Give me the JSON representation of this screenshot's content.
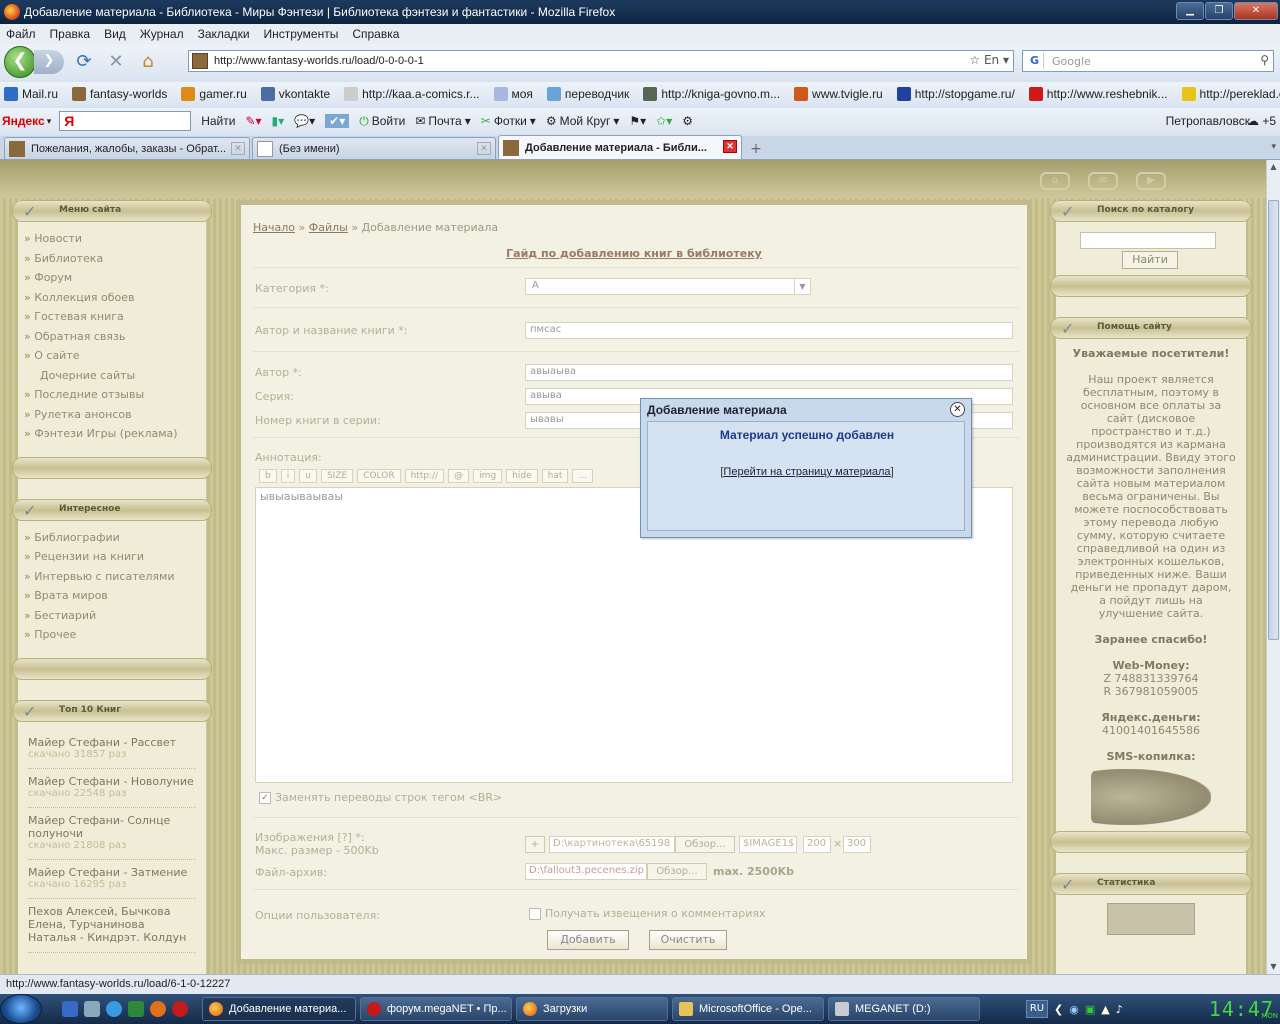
{
  "window": {
    "title": "Добавление материала - Библиотека - Миры Фэнтези | Библиотека фэнтези и фантастики - Mozilla Firefox"
  },
  "menu": [
    "Файл",
    "Правка",
    "Вид",
    "Журнал",
    "Закладки",
    "Инструменты",
    "Справка"
  ],
  "nav": {
    "url": "http://www.fantasy-worlds.ru/load/0-0-0-0-1",
    "search_placeholder": "Google",
    "lang": "En"
  },
  "bookmarks": [
    {
      "label": "Mail.ru",
      "icon": "at-icon",
      "color": "#2d6ec7"
    },
    {
      "label": "fantasy-worlds",
      "icon": "book-icon",
      "color": "#8a6a3c"
    },
    {
      "label": "gamer.ru",
      "icon": "gamer-icon",
      "color": "#e08a1a"
    },
    {
      "label": "vkontakte",
      "icon": "vk-icon",
      "color": "#4a6ea0"
    },
    {
      "label": "http://kaa.a-comics.r...",
      "icon": "page-icon",
      "color": "#cccccc"
    },
    {
      "label": "моя",
      "icon": "crystal-icon",
      "color": "#a8b8e0"
    },
    {
      "label": "переводчик",
      "icon": "translate-icon",
      "color": "#6aa3d8"
    },
    {
      "label": "http://kniga-govno.m...",
      "icon": "skull-icon",
      "color": "#556655"
    },
    {
      "label": "www.tvigle.ru",
      "icon": "tvigle-icon",
      "color": "#d05a1a"
    },
    {
      "label": "http://stopgame.ru/",
      "icon": "stopgame-icon",
      "color": "#2240a0"
    },
    {
      "label": "http://www.reshebnik...",
      "icon": "reshebnik-icon",
      "color": "#d01a1a"
    },
    {
      "label": "http://pereklad.online....",
      "icon": "smile-icon",
      "color": "#e8c41a"
    }
  ],
  "yandex": {
    "logo": "Яндекс",
    "find": "Найти",
    "login": "Войти",
    "mail": "Почта",
    "photos": "Фотки",
    "circle": "Мой Круг",
    "city": "Петропавловск",
    "temp": "+5"
  },
  "tabs": [
    {
      "label": "Пожелания, жалобы, заказы - Обрат...",
      "active": false
    },
    {
      "label": "(Без имени)",
      "active": false
    },
    {
      "label": "Добавление материала - Библи...",
      "active": true
    }
  ],
  "left_menu": {
    "title": "Меню сайта",
    "items": [
      "Новости",
      "Библиотека",
      "Форум",
      "Коллекция обоев",
      "Гостевая книга",
      "Обратная связь",
      "О сайте",
      "Дочерние сайты",
      "Последние отзывы",
      "Рулетка анонсов",
      "Фэнтези Игры (реклама)"
    ]
  },
  "left_interesting": {
    "title": "Интересное",
    "items": [
      "Библиографии",
      "Рецензии на книги",
      "Интервью с писателями",
      "Врата миров",
      "Бестиарий",
      "Прочее"
    ]
  },
  "top_books": {
    "title": "Топ 10 Книг",
    "items": [
      {
        "title": "Майер Стефани - Рассвет",
        "count": "скачано 31857 раз"
      },
      {
        "title": "Майер Стефани - Новолуние",
        "count": "скачано 22548 раз"
      },
      {
        "title": "Майер Стефани- Солнце полуночи",
        "count": "скачано 21808 раз"
      },
      {
        "title": "Майер Стефани - Затмение",
        "count": "скачано 16295 раз"
      },
      {
        "title": "Пехов Алексей, Бычкова Елена, Турчанинова Наталья - Киндрэт. Колдун",
        "count": ""
      }
    ]
  },
  "form": {
    "breadcrumb": {
      "home": "Начало",
      "files": "Файлы",
      "current": "Добавление материала",
      "sep": "»"
    },
    "guide_link": "Гайд по добавлению книг в библиотеку",
    "category_label": "Категория *:",
    "category_value": "А",
    "title_label": "Автор и название книги *:",
    "title_value": "пмсас",
    "author_label": "Автор *:",
    "author_value": "авыаыва",
    "series_label": "Серия:",
    "series_value": "авыва",
    "number_label": "Номер книги в серии:",
    "number_value": "ывавы",
    "annotation_label": "Аннотация:",
    "bb_buttons": [
      "b",
      "i",
      "u",
      "SIZE",
      "COLOR",
      "http://",
      "@",
      "img",
      "hide",
      "hat",
      "..."
    ],
    "annotation_text": "ывыаываываы",
    "replace_br": "Заменять переводы строк тегом <BR>",
    "images_label": "Изображения [?] *:",
    "max_size": "Макс. размер - 500Kb",
    "image_path": "D:\\картинотека\\65198",
    "browse": "Обзор...",
    "image_name": "$IMAGE1$",
    "img_w": "200",
    "img_h": "300",
    "archive_label": "Файл-архив:",
    "archive_path": "D:\\fallout3.pecenes.zip",
    "archive_max": "max. 2500Kb",
    "options_label": "Опции пользователя:",
    "notify": "Получать извещения о комментариях",
    "submit": "Добавить",
    "clear": "Очистить"
  },
  "right": {
    "search_title": "Поиск по каталогу",
    "search_btn": "Найти",
    "help_title": "Помощь сайту",
    "dear": "Уважаемые посетители!",
    "text": "Наш проект является бесплатным, поэтому в основном все оплаты за сайт (дисковое пространство и т.д.) производятся из кармана администрации. Ввиду этого возможности заполнения сайта новым материалом весьма ограничены. Вы можете поспособствовать этому перевода любую сумму, которую считаете справедливой на один из электронных кошельков, приведенных ниже. Ваши деньги не пропадут даром, а пойдут лишь на улучшение сайта.",
    "thanks": "Заранее спасибо!",
    "webmoney": "Web-Money:",
    "wm_z": "Z 748831339764",
    "wm_r": "R 367981059005",
    "yandex_money": "Яндекс.деньги:",
    "ym_num": "41001401645586",
    "sms": "SMS-копилка:",
    "stats_title": "Статистика"
  },
  "dialog": {
    "title": "Добавление материала",
    "message": "Материал успешно добавлен",
    "link": "Перейти на страницу материала"
  },
  "status": "http://www.fantasy-worlds.ru/load/6-1-0-12227",
  "taskbar": [
    {
      "label": "Добавление материа...",
      "active": true
    },
    {
      "label": "форум.megaNET • Пр...",
      "active": false
    },
    {
      "label": "Загрузки",
      "active": false
    },
    {
      "label": "MicrosoftOffice - Ope...",
      "active": false
    },
    {
      "label": "MEGANET (D:)",
      "active": false
    }
  ],
  "tray": {
    "lang": "RU",
    "clock": "14:47",
    "dow": "MON"
  }
}
